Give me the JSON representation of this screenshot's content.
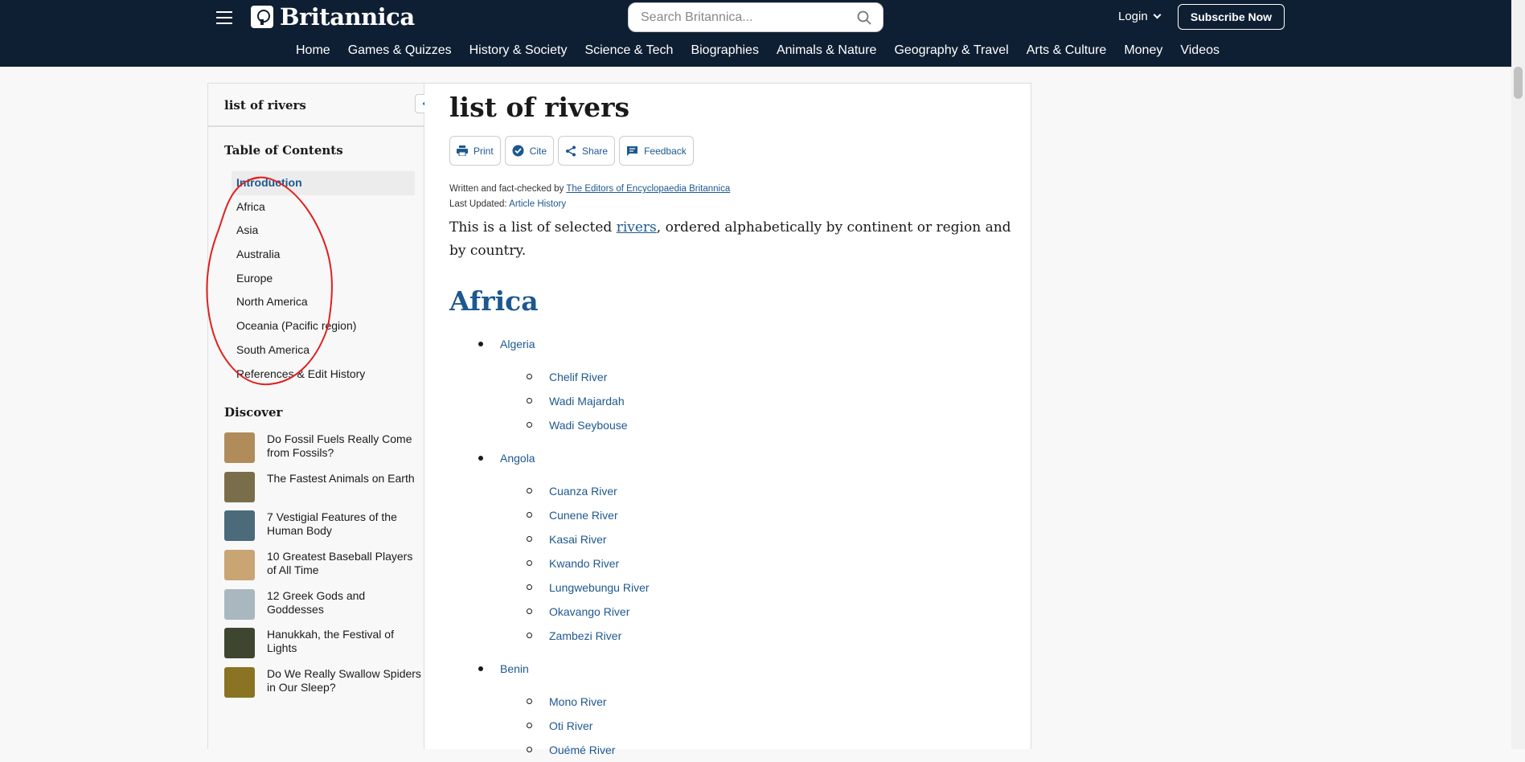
{
  "header": {
    "brand": "Britannica",
    "search_placeholder": "Search Britannica...",
    "login_label": "Login",
    "subscribe_label": "Subscribe Now",
    "nav": [
      "Home",
      "Games & Quizzes",
      "History & Society",
      "Science & Tech",
      "Biographies",
      "Animals & Nature",
      "Geography & Travel",
      "Arts & Culture",
      "Money",
      "Videos"
    ]
  },
  "sidebar": {
    "title": "list of rivers",
    "toc_heading": "Table of Contents",
    "toc": [
      "Introduction",
      "Africa",
      "Asia",
      "Australia",
      "Europe",
      "North America",
      "Oceania (Pacific region)",
      "South America",
      "References & Edit History"
    ],
    "active_index": 0,
    "discover_heading": "Discover",
    "discover": [
      {
        "text": "Do Fossil Fuels Really Come from Fossils?",
        "thumb_color": "#b08c5a"
      },
      {
        "text": "The Fastest Animals on Earth",
        "thumb_color": "#7a6e4a"
      },
      {
        "text": "7 Vestigial Features of the Human Body",
        "thumb_color": "#4b6b7a"
      },
      {
        "text": "10 Greatest Baseball Players of All Time",
        "thumb_color": "#c9a574"
      },
      {
        "text": "12 Greek Gods and Goddesses",
        "thumb_color": "#a9b7bf"
      },
      {
        "text": "Hanukkah, the Festival of Lights",
        "thumb_color": "#3f4630"
      },
      {
        "text": "Do We Really Swallow Spiders in Our Sleep?",
        "thumb_color": "#8a7424"
      }
    ]
  },
  "article": {
    "title": "list of rivers",
    "tools": [
      "Print",
      "Cite",
      "Share",
      "Feedback"
    ],
    "written_by_label": "Written and fact-checked by",
    "written_by": "The Editors of Encyclopaedia Britannica",
    "last_updated_label": "Last Updated:",
    "last_updated": "Article History",
    "intro_before": "This is a list of selected ",
    "intro_link": "rivers",
    "intro_after": ", ordered alphabetically by continent or region and by country.",
    "section_heading": "Africa",
    "countries": [
      {
        "name": "Algeria",
        "rivers": [
          "Chelif River",
          "Wadi Majardah",
          "Wadi Seybouse"
        ]
      },
      {
        "name": "Angola",
        "rivers": [
          "Cuanza River",
          "Cunene River",
          "Kasai River",
          "Kwando River",
          "Lungwebungu River",
          "Okavango River",
          "Zambezi River"
        ]
      },
      {
        "name": "Benin",
        "rivers": [
          "Mono River",
          "Oti River",
          "Ouémé River"
        ]
      }
    ]
  },
  "colors": {
    "header_bg": "#0f1f33",
    "link": "#1d5890",
    "annotation": "#e02020"
  }
}
